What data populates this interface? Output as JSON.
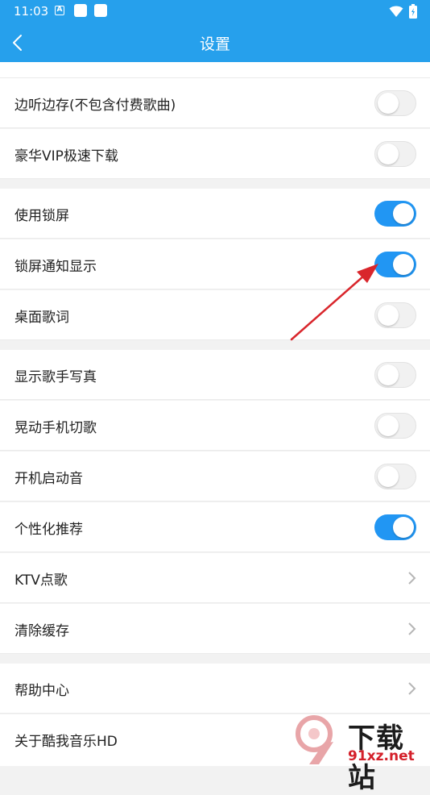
{
  "status_bar": {
    "time": "11:03",
    "icon_a": "A"
  },
  "header": {
    "title": "设置"
  },
  "rows": [
    {
      "label": "边听边存(不包含付费歌曲)",
      "control": "toggle",
      "on": false
    },
    {
      "label": "豪华VIP极速下载",
      "control": "toggle",
      "on": false
    },
    {
      "label": "使用锁屏",
      "control": "toggle",
      "on": true
    },
    {
      "label": "锁屏通知显示",
      "control": "toggle",
      "on": true
    },
    {
      "label": "桌面歌词",
      "control": "toggle",
      "on": false
    },
    {
      "label": "显示歌手写真",
      "control": "toggle",
      "on": false
    },
    {
      "label": "晃动手机切歌",
      "control": "toggle",
      "on": false
    },
    {
      "label": "开机启动音",
      "control": "toggle",
      "on": false
    },
    {
      "label": "个性化推荐",
      "control": "toggle",
      "on": true
    },
    {
      "label": "KTV点歌",
      "control": "chevron"
    },
    {
      "label": "清除缓存",
      "control": "chevron"
    },
    {
      "label": "帮助中心",
      "control": "chevron"
    },
    {
      "label": "关于酷我音乐HD",
      "control": "chevron"
    }
  ],
  "watermark": {
    "text": "下载站",
    "url": "91xz.net"
  },
  "colors": {
    "accent": "#26a0ec",
    "toggle_on": "#2196f3",
    "arrow": "#d9262c",
    "background": "#f2f2f2"
  },
  "icons": {
    "back": "chevron-left-icon",
    "row_arrow": "chevron-right-icon"
  }
}
